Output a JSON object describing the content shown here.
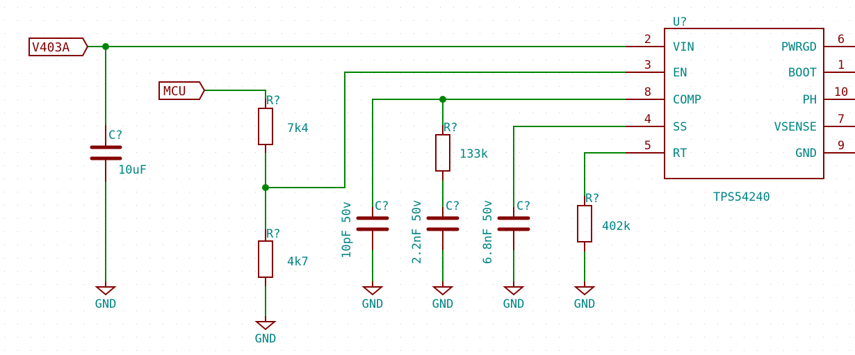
{
  "schematic": {
    "colors": {
      "wire": "#008400",
      "component": "#840000",
      "text": "#008484",
      "background": "#ffffff",
      "grid": "#c8c8c8"
    },
    "labels": {
      "vin_net": "V403A",
      "mcu_net": "MCU"
    },
    "ic": {
      "reference": "U?",
      "part": "TPS54240",
      "left_pins": [
        {
          "number": "2",
          "name": "VIN"
        },
        {
          "number": "3",
          "name": "EN"
        },
        {
          "number": "8",
          "name": "COMP"
        },
        {
          "number": "4",
          "name": "SS"
        },
        {
          "number": "5",
          "name": "RT"
        }
      ],
      "right_pins": [
        {
          "number": "6",
          "name": "PWRGD"
        },
        {
          "number": "1",
          "name": "BOOT"
        },
        {
          "number": "10",
          "name": "PH"
        },
        {
          "number": "7",
          "name": "VSENSE"
        },
        {
          "number": "9",
          "name": "GND"
        }
      ]
    },
    "components": {
      "c_in": {
        "ref": "C?",
        "value": "10uF"
      },
      "r_en_top": {
        "ref": "R?",
        "value": "7k4"
      },
      "r_en_bot": {
        "ref": "R?",
        "value": "4k7"
      },
      "c_comp_hf": {
        "ref": "C?",
        "value": "10pF 50v"
      },
      "r_comp": {
        "ref": "R?",
        "value": "133k"
      },
      "c_comp": {
        "ref": "C?",
        "value": "2.2nF 50v"
      },
      "c_ss": {
        "ref": "C?",
        "value": "6.8nF 50v"
      },
      "r_rt": {
        "ref": "R?",
        "value": "402k"
      }
    },
    "gnd_label": "GND"
  }
}
